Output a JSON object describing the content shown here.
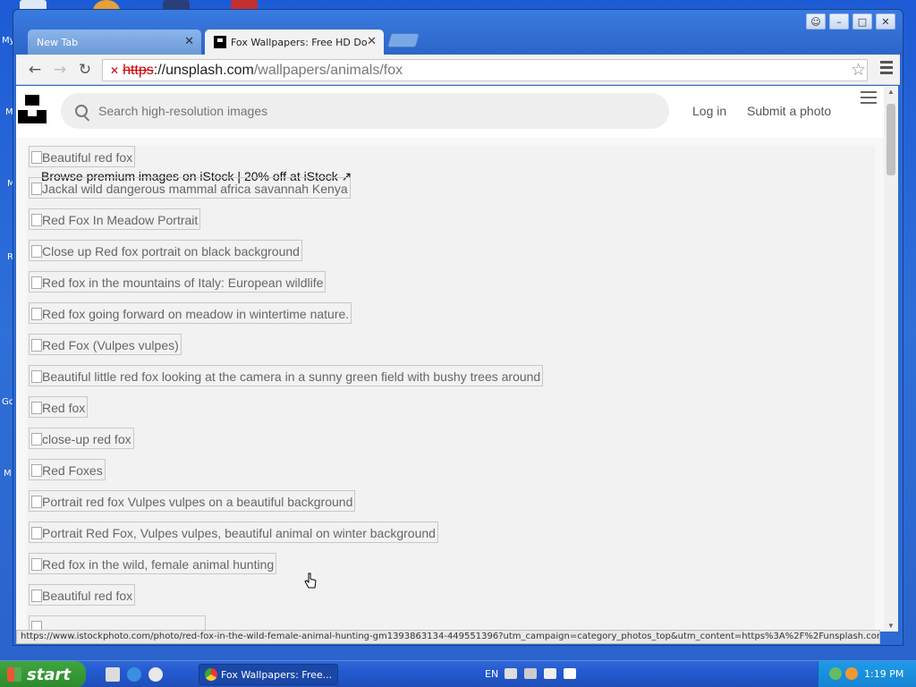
{
  "desktop": {
    "labels": [
      "My",
      "M",
      "M",
      "R",
      "Gc",
      "M"
    ]
  },
  "window": {
    "controls": [
      "☺",
      "–",
      "□",
      "✕"
    ]
  },
  "tabs": [
    {
      "label": "New Tab",
      "close": "✕"
    },
    {
      "label": "Fox Wallpapers: Free HD Do",
      "close": "✕"
    }
  ],
  "toolbar": {
    "back": "←",
    "forward": "→",
    "reload": "↻",
    "url_scheme": "https",
    "url_domain": "://unsplash.com",
    "url_path": "/wallpapers/animals/fox",
    "star": "☆"
  },
  "site": {
    "search_placeholder": "Search high-resolution images",
    "login": "Log in",
    "submit": "Submit a photo",
    "istock_banner": "Browse premium images on iStock | 20% off at iStock ↗"
  },
  "images": [
    "Beautiful red fox",
    "Jackal wild dangerous mammal africa savannah Kenya",
    "Red Fox In Meadow Portrait",
    "Close up Red fox portrait on black background",
    "Red fox in the mountains of Italy: European wildlife",
    "Red fox going forward on meadow in wintertime nature.",
    "Red Fox (Vulpes vulpes)",
    "Beautiful little red fox looking at the camera in a sunny green field with bushy trees around",
    "Red fox",
    "close-up red fox",
    "Red Foxes",
    "Portrait red fox Vulpes vulpes on a beautiful background",
    "Portrait Red Fox, Vulpes vulpes, beautiful animal on winter background",
    "Red fox in the wild, female animal hunting",
    "Beautiful red fox"
  ],
  "status_url": "https://www.istockphoto.com/photo/red-fox-in-the-wild-female-animal-hunting-gm1393863134-449551396?utm_campaign=category_photos_top&utm_content=https%3A%2F%2Funsplash.com...",
  "taskbar": {
    "start": "start",
    "task_label": "Fox Wallpapers: Free...",
    "lang": "EN",
    "clock": "1:19 PM"
  }
}
